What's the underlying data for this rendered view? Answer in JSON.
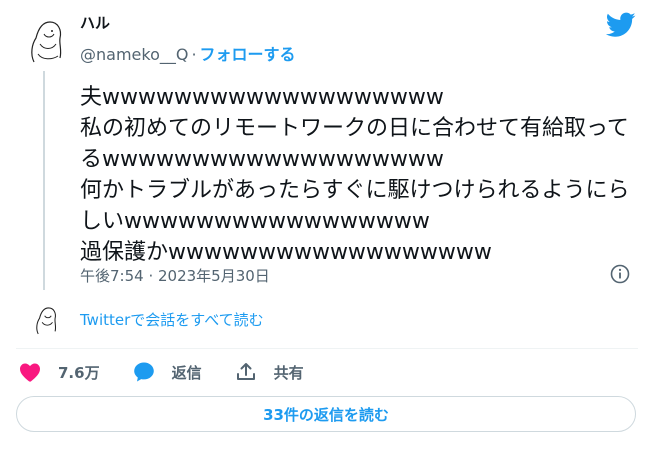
{
  "author": {
    "display_name": "ハル",
    "handle": "@nameko__Q",
    "separator": "·",
    "follow_label": "フォローする"
  },
  "tweet": {
    "text": "夫wwwwwwwwwwwwwwwwwww\n私の初めてのリモートワークの日に合わせて有給取ってるwwwwwwwwwwwwwwwwwww\n何かトラブルがあったらすぐに駆けつけられるようにらしいwwwwwwwwwwwwwwwww\n過保護かwwwwwwwwwwwwwwwwww",
    "timestamp": "午後7:54 · 2023年5月30日"
  },
  "conversation": {
    "link_label": "Twitterで会話をすべて読む"
  },
  "actions": {
    "likes_count": "7.6万",
    "reply_label": "返信",
    "share_label": "共有"
  },
  "replies": {
    "button_label": "33件の返信を読む"
  },
  "colors": {
    "accent": "#1d9bf0",
    "like": "#f91880",
    "secondary_text": "#536471"
  },
  "icons": [
    "twitter-bird-icon",
    "info-icon",
    "heart-icon",
    "reply-bubble-icon",
    "share-icon"
  ]
}
